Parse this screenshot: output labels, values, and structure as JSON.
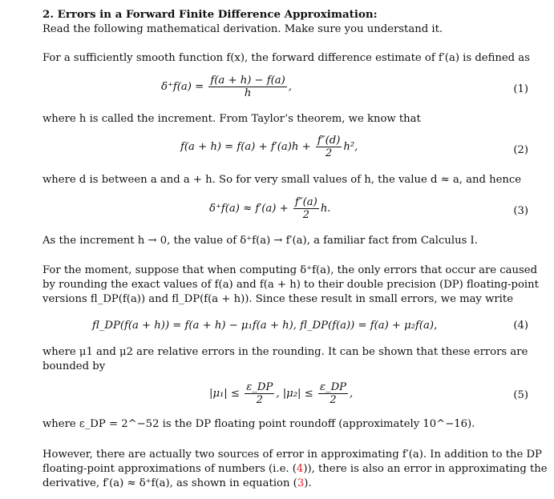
{
  "section": {
    "title": "2. Errors in a Forward Finite Difference Approximation:",
    "intro": "Read the following mathematical derivation. Make sure you understand it."
  },
  "paragraphs": {
    "p1": "For a sufficiently smooth function f(x), the forward difference estimate of f′(a) is defined as",
    "p2": "where h is called the increment. From Taylor’s theorem, we know that",
    "p3": "where d is between a and a + h. So for very small values of h, the value d ≈ a, and hence",
    "p4": "As the increment h → 0, the value of δ⁺f(a) → f′(a), a familiar fact from Calculus I.",
    "p5_l1": "For the moment, suppose that when computing δ⁺f(a), the only errors that occur are caused",
    "p5_l2": "by rounding the exact values of f(a) and f(a + h) to their double precision (DP) floating-point",
    "p5_l3": "versions fl_DP(f(a)) and fl_DP(f(a + h)). Since these result in small errors, we may write",
    "p6_l1": "where μ1 and μ2 are relative errors in the rounding. It can be shown that these errors are",
    "p6_l2": "bounded by",
    "p7": "where ε_DP = 2^−52 is the DP floating point roundoff (approximately 10^−16).",
    "p8_l1": "However, there are actually two sources of error in approximating f′(a). In addition to the DP",
    "p8_l2_a": "floating-point approximations of numbers (i.e. (",
    "p8_l2_b": ")), there is also an error in approximating the",
    "p8_l3_a": "derivative, f′(a) ≈ δ⁺f(a), as shown in equation (",
    "p8_l3_b": ")."
  },
  "equations": {
    "eq1": {
      "lhs": "δ⁺f(a) =",
      "num": "f(a + h) − f(a)",
      "den": "h",
      "tail": ",",
      "number": "(1)"
    },
    "eq2": {
      "lhs": "f(a + h) = f(a) + f′(a)h +",
      "num": "f″(d)",
      "den": "2",
      "tail": "h², ",
      "number": "(2)"
    },
    "eq3": {
      "lhs": "δ⁺f(a) ≈ f′(a) +",
      "num": "f″(a)",
      "den": "2",
      "tail": "h.",
      "number": "(3)"
    },
    "eq4": {
      "text": "fl_DP(f(a + h)) = f(a + h) − μ₁f(a + h),    fl_DP(f(a)) = f(a) + μ₂f(a),",
      "number": "(4)"
    },
    "eq5": {
      "a_lhs": "|μ₁| ≤",
      "a_num": "ε_DP",
      "a_den": "2",
      "b_lhs": ",   |μ₂| ≤",
      "b_num": "ε_DP",
      "b_den": "2",
      "tail": ",",
      "number": "(5)"
    }
  },
  "references": {
    "ref4": "4",
    "ref3": "3",
    "color": "#e8202a"
  }
}
